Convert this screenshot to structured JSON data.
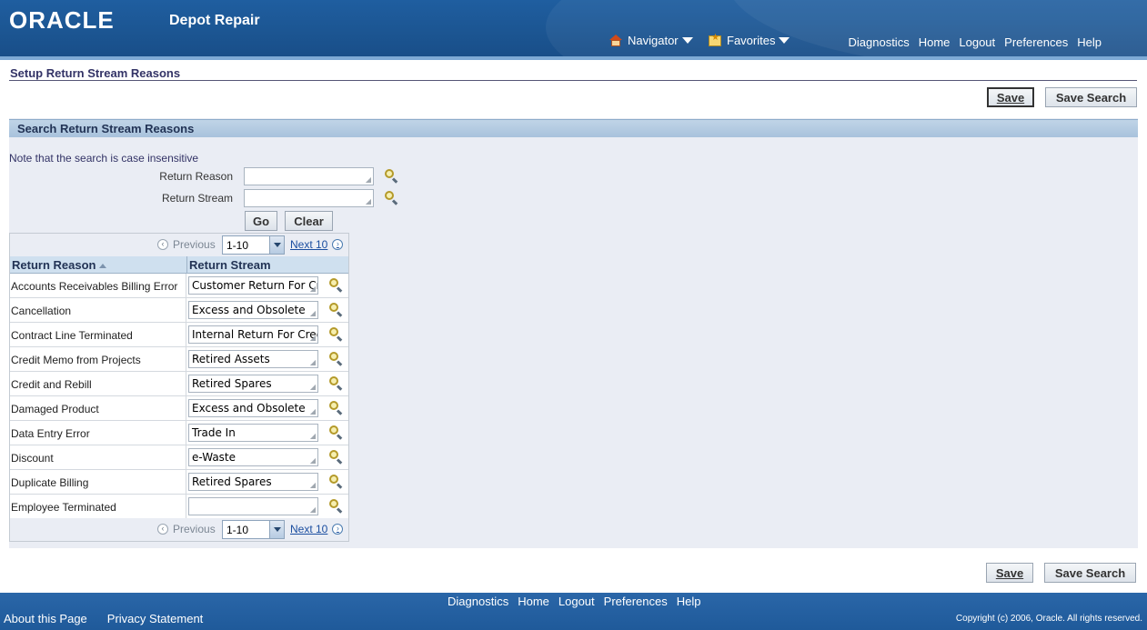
{
  "header": {
    "logo": "ORACLE",
    "app_title": "Depot Repair",
    "navigator": "Navigator",
    "favorites": "Favorites",
    "links": [
      "Diagnostics",
      "Home",
      "Logout",
      "Preferences",
      "Help"
    ]
  },
  "page": {
    "title": "Setup Return Stream Reasons",
    "save_label": "Save",
    "save_search_label": "Save Search"
  },
  "search": {
    "region_title": "Search Return Stream Reasons",
    "note": "Note that the search is case insensitive",
    "return_reason_label": "Return Reason",
    "return_reason_value": "",
    "return_stream_label": "Return Stream",
    "return_stream_value": "",
    "go_label": "Go",
    "clear_label": "Clear"
  },
  "pagination": {
    "previous": "Previous",
    "range": "1-10",
    "next": "Next 10"
  },
  "table": {
    "columns": [
      "Return Reason",
      "Return Stream"
    ],
    "rows": [
      {
        "reason": "Accounts Receivables Billing Error",
        "stream": "Customer Return For Credit"
      },
      {
        "reason": "Cancellation",
        "stream": "Excess and Obsolete"
      },
      {
        "reason": "Contract Line Terminated",
        "stream": "Internal Return For Credit"
      },
      {
        "reason": "Credit Memo from Projects",
        "stream": "Retired Assets"
      },
      {
        "reason": "Credit and Rebill",
        "stream": "Retired Spares"
      },
      {
        "reason": "Damaged Product",
        "stream": "Excess and Obsolete"
      },
      {
        "reason": "Data Entry Error",
        "stream": "Trade In"
      },
      {
        "reason": "Discount",
        "stream": "e-Waste"
      },
      {
        "reason": "Duplicate Billing",
        "stream": "Retired Spares"
      },
      {
        "reason": "Employee Terminated",
        "stream": ""
      }
    ]
  },
  "footer": {
    "links": [
      "Diagnostics",
      "Home",
      "Logout",
      "Preferences",
      "Help"
    ],
    "about": "About this Page",
    "privacy": "Privacy Statement",
    "copyright": "Copyright (c) 2006, Oracle. All rights reserved."
  }
}
